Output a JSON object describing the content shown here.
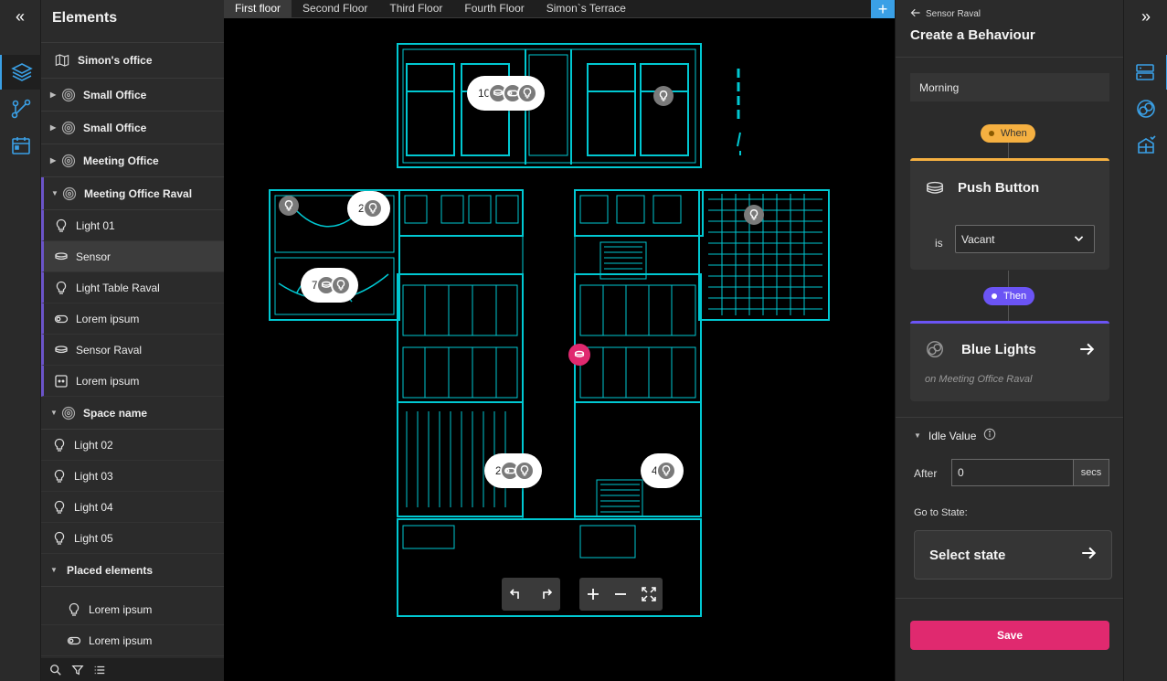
{
  "colors": {
    "accent": "#3aa0e6",
    "cyan": "#00c8d2",
    "save": "#e0296f",
    "when": "#f5b041",
    "then": "#6b54f5"
  },
  "rail": {
    "collapse_icon": "chevrons-left-icon",
    "icons": [
      "layers-icon",
      "graph-icon",
      "calendar-icon"
    ]
  },
  "elements": {
    "title": "Elements",
    "building": "Simon's office",
    "spaces": [
      {
        "label": "Small Office"
      },
      {
        "label": "Small Office"
      },
      {
        "label": "Meeting Office"
      }
    ],
    "expanded_space": "Meeting Office Raval",
    "expanded_items": [
      {
        "label": "Light 01",
        "icon": "bulb-icon"
      },
      {
        "label": "Sensor",
        "icon": "sensor-icon"
      },
      {
        "label": "Light Table Raval",
        "icon": "bulb-icon"
      },
      {
        "label": "Lorem ipsum",
        "icon": "toggle-icon"
      },
      {
        "label": "Sensor Raval",
        "icon": "sensor-icon"
      },
      {
        "label": "Lorem ipsum",
        "icon": "outlet-icon"
      }
    ],
    "space_name": "Space name",
    "space_items": [
      {
        "label": "Light 02"
      },
      {
        "label": "Light 03"
      },
      {
        "label": "Light 04"
      },
      {
        "label": "Light 05"
      }
    ],
    "placed_title": "Placed elements",
    "placed_items": [
      {
        "label": "Lorem ipsum",
        "icon": "bulb-icon"
      },
      {
        "label": "Lorem ipsum",
        "icon": "toggle-icon"
      }
    ]
  },
  "tabs": [
    "First floor",
    "Second Floor",
    "Third Floor",
    "Fourth Floor",
    "Simon`s Terrace"
  ],
  "map": {
    "clusters": [
      {
        "count": "10"
      },
      {
        "count": "2"
      },
      {
        "count": "7"
      },
      {
        "count": "2"
      },
      {
        "count": "4"
      }
    ]
  },
  "behaviour": {
    "back_label": "Sensor Raval",
    "title": "Create a Behaviour",
    "name_value": "Morning",
    "when_label": "When",
    "trigger_title": "Push Button",
    "is_label": "is",
    "trigger_state": "Vacant",
    "then_label": "Then",
    "action_title": "Blue Lights",
    "action_location": "on Meeting Office Raval",
    "idle_title": "Idle Value",
    "after_label": "After",
    "after_value": "0",
    "secs_label": "secs",
    "goto_label": "Go to State:",
    "select_state": "Select state",
    "save_label": "Save"
  }
}
